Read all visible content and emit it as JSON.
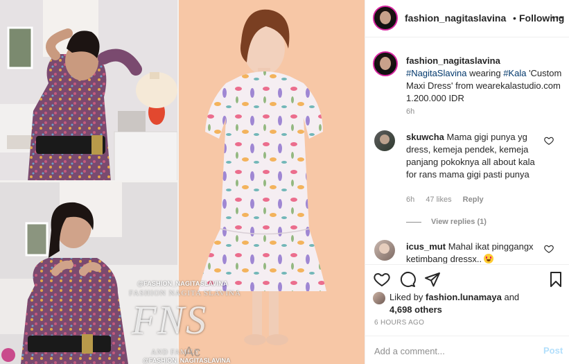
{
  "post_media": {
    "watermark_handle": "@FASHION_NAGITASLAVINA",
    "watermark_name": "FASHION NAGITA SLAVINA",
    "watermark_monogram": "FNS",
    "watermark_family": "AND FAMILY",
    "watermark_handle_bottom": "@FASHION_NAGITASLAVINA"
  },
  "header": {
    "username": "fashion_nagitaslavina",
    "dot": "•",
    "follow_status": "Following",
    "more_icon": "more-options-icon"
  },
  "caption": {
    "username": "fashion_nagitaslavina",
    "tag1": "#NagitaSlavina",
    "text1": " wearing ",
    "tag2": "#Kala",
    "text2": " 'Custom Maxi Dress' from wearekalastudio.com 1.200.000 IDR",
    "time": "6h"
  },
  "comments": [
    {
      "username": "skuwcha",
      "text": "Mama gigi punya yg dress, kemeja pendek, kemeja panjang pokoknya all about kala for rans mama gigi pasti punya",
      "time": "6h",
      "likes": "47 likes",
      "reply": "Reply",
      "view_replies": "View replies (1)"
    },
    {
      "username": "icus_mut",
      "text": "Mahal ikat pinggangx ketimbang dressx..",
      "emoji": "heart-eyes-emoji"
    }
  ],
  "actions": {
    "icons": [
      "heart-icon",
      "comment-icon",
      "share-icon",
      "bookmark-icon"
    ]
  },
  "likes": {
    "prefix": "Liked by ",
    "user": "fashion.lunamaya",
    "middle": " and",
    "others": "4,698 others"
  },
  "timestamp": "6 HOURS AGO",
  "comment_box": {
    "placeholder": "Add a comment...",
    "post_label": "Post"
  },
  "os_watermark": "Ac",
  "colors": {
    "text": "#262626",
    "muted": "#8e8e8e",
    "hashtag": "#00376b",
    "post_button": "#b2dffc",
    "story_ring": "#d6249f"
  }
}
